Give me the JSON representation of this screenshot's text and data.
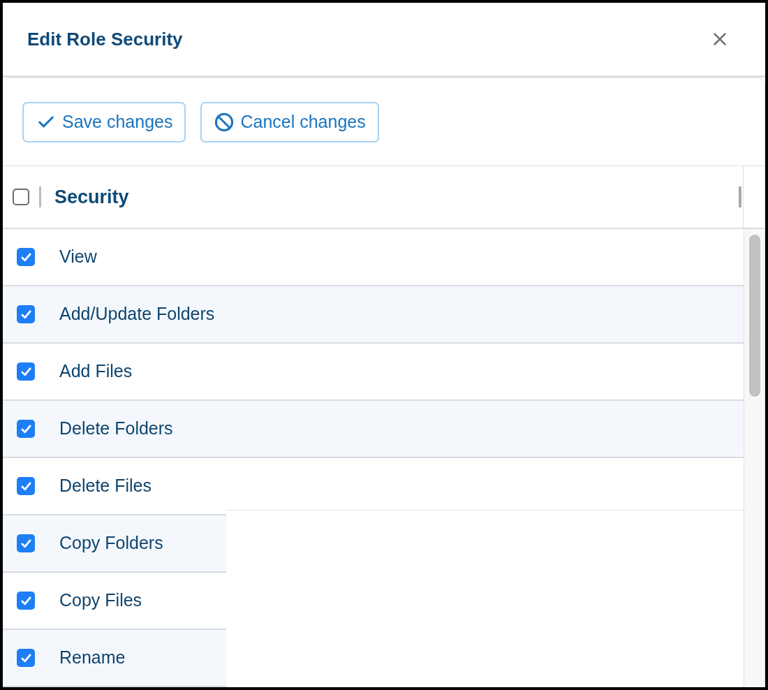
{
  "dialog": {
    "title": "Edit Role Security"
  },
  "toolbar": {
    "buttons": [
      {
        "kind": "save",
        "label": "Save changes"
      },
      {
        "kind": "cancel",
        "label": "Cancel changes"
      }
    ]
  },
  "table": {
    "header": {
      "label": "Security",
      "checked": false
    },
    "rows": [
      {
        "label": "View",
        "checked": true
      },
      {
        "label": "Add/Update Folders",
        "checked": true
      },
      {
        "label": "Add Files",
        "checked": true
      },
      {
        "label": "Delete Folders",
        "checked": true
      },
      {
        "label": "Delete Files",
        "checked": true
      },
      {
        "label": "Copy Folders",
        "checked": true
      },
      {
        "label": "Copy Files",
        "checked": true
      },
      {
        "label": "Rename",
        "checked": true
      }
    ]
  }
}
